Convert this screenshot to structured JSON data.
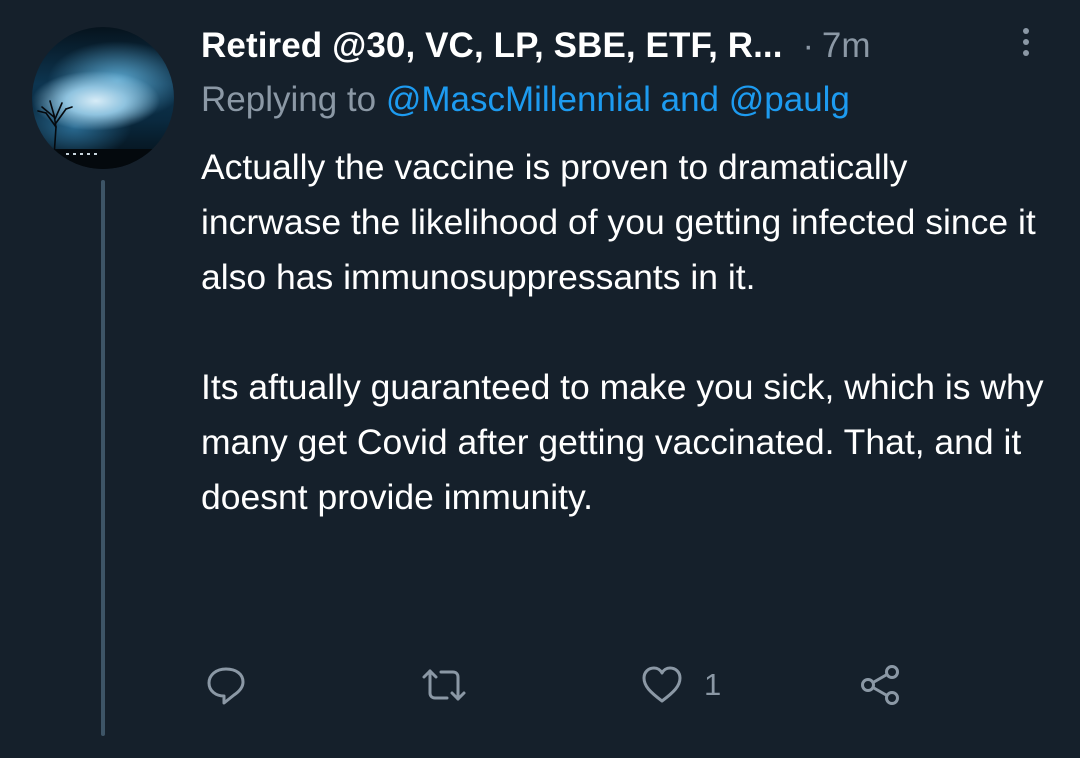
{
  "tweet": {
    "display_name": "Retired @30, VC, LP, SBE, ETF, R...",
    "separator": "·",
    "time": "7m",
    "replying_prefix": "Replying to",
    "replying_to": "@MascMillennial and @paulg",
    "paragraphs": [
      "Actually the vaccine is proven to dramatically incrwase the likelihood of you getting infected since it also has immunosuppressants in it.",
      "Its aftually guaranteed to make you sick, which is why many get Covid after getting vaccinated. That, and it doesnt provide immunity."
    ]
  },
  "actions": {
    "reply_icon": "reply-icon",
    "retweet_icon": "retweet-icon",
    "like_icon": "heart-icon",
    "like_count": "1",
    "share_icon": "share-icon"
  },
  "colors": {
    "background": "#15202b",
    "text": "#ffffff",
    "secondary": "#8b98a5",
    "link": "#1d9bf0",
    "thread_line": "#3d5466"
  }
}
